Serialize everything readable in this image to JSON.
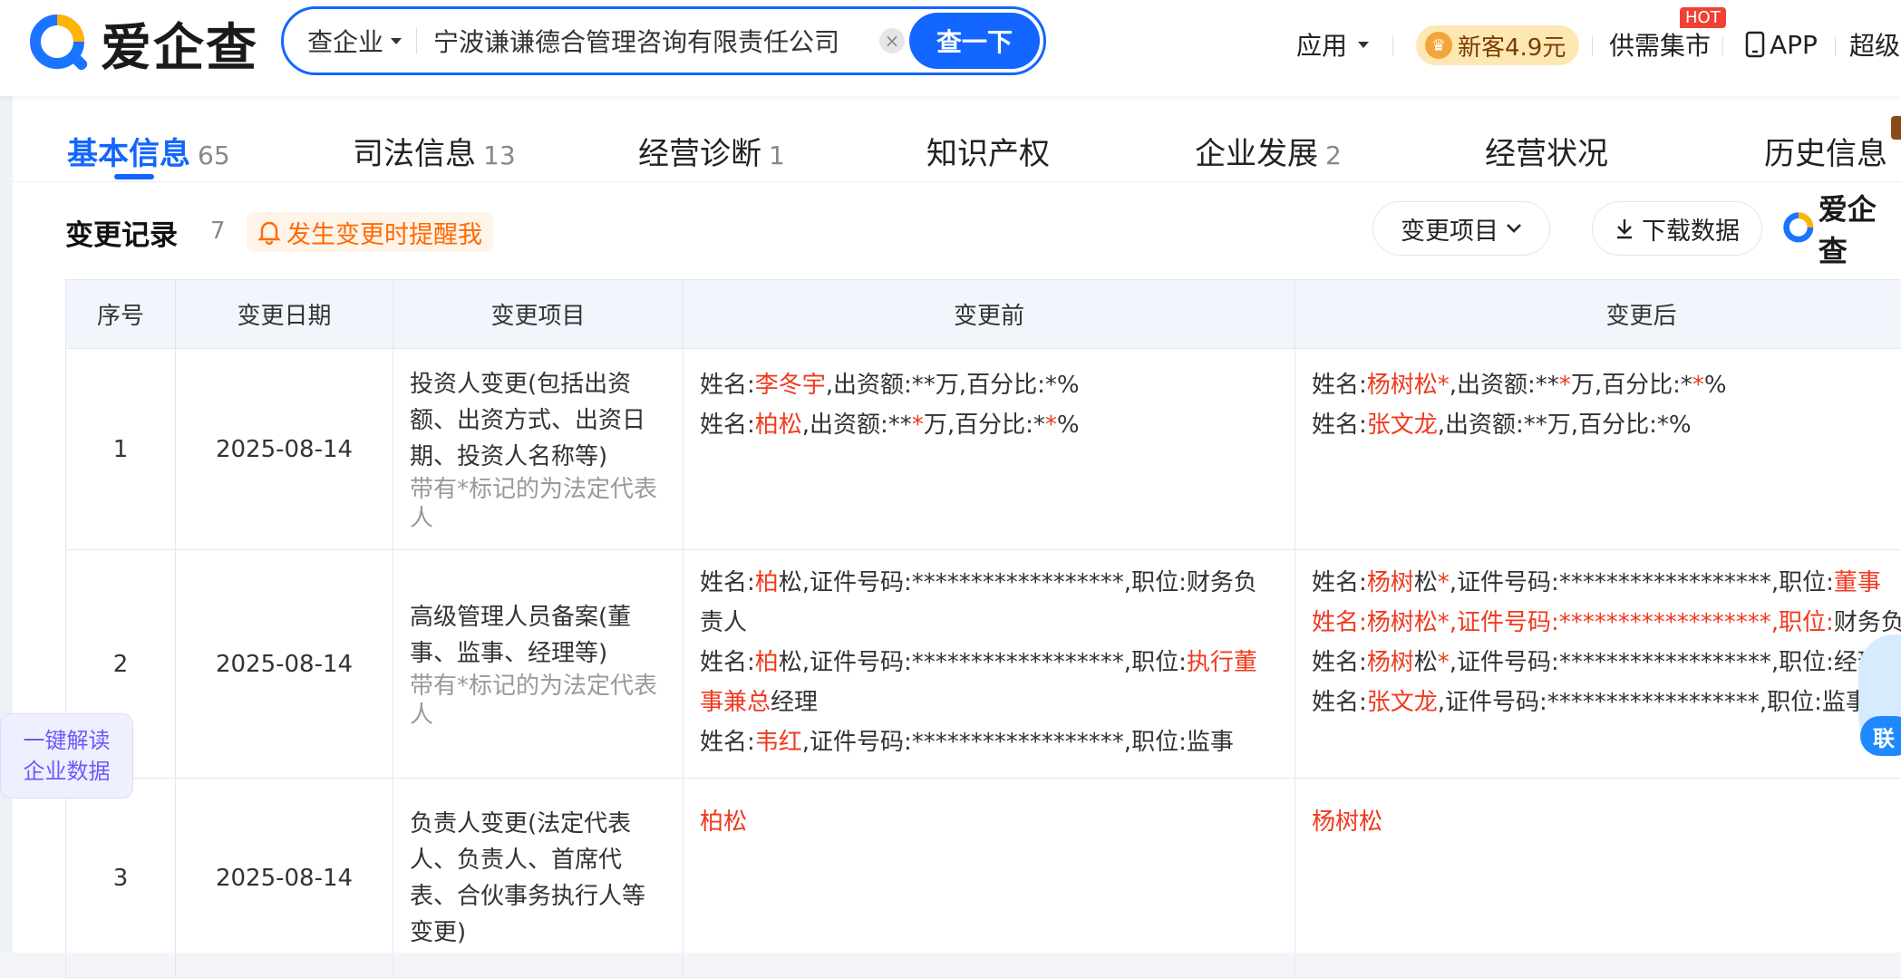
{
  "header": {
    "logo_text": "爱企查",
    "search": {
      "type_label": "查企业",
      "value": "宁波谦谦德合管理咨询有限责任公司",
      "clear_symbol": "×",
      "button": "查一下"
    },
    "nav": {
      "apps": "应用",
      "promo": "新客4.9元",
      "market": "供需集市",
      "hot_badge": "HOT",
      "app": "APP",
      "more": "超级"
    }
  },
  "tabs": [
    {
      "label": "基本信息",
      "count": "65"
    },
    {
      "label": "司法信息",
      "count": "13"
    },
    {
      "label": "经营诊断",
      "count": "1"
    },
    {
      "label": "知识产权",
      "count": ""
    },
    {
      "label": "企业发展",
      "count": "2"
    },
    {
      "label": "经营状况",
      "count": ""
    },
    {
      "label": "历史信息",
      "count": ""
    }
  ],
  "section": {
    "title": "变更记录",
    "count": "7",
    "remind": "发生变更时提醒我",
    "filter": "变更项目",
    "download": "下载数据",
    "watermark": "爱企查"
  },
  "table": {
    "headers": [
      "序号",
      "变更日期",
      "变更项目",
      "变更前",
      "变更后"
    ],
    "rows": [
      {
        "no": "1",
        "date": "2025-08-14",
        "item": "投资人变更(包括出资额、出资方式、出资日期、投资人名称等)",
        "note": "带有*标记的为法定代表人",
        "before": [
          [
            {
              "t": "姓名:"
            },
            {
              "t": "李冬宇",
              "r": true
            },
            {
              "t": ",出资额:**万,百分比:*%"
            }
          ],
          [
            {
              "t": "姓名:"
            },
            {
              "t": "柏松",
              "r": true
            },
            {
              "t": ",出资额:**"
            },
            {
              "t": "*",
              "r": true
            },
            {
              "t": "万,百分比:*"
            },
            {
              "t": "*",
              "r": true
            },
            {
              "t": "%"
            }
          ]
        ],
        "after": [
          [
            {
              "t": "姓名:"
            },
            {
              "t": "杨树松*",
              "r": true
            },
            {
              "t": ",出资额:**"
            },
            {
              "t": "*",
              "r": true
            },
            {
              "t": "万,百分比:*"
            },
            {
              "t": "*",
              "r": true
            },
            {
              "t": "%"
            }
          ],
          [
            {
              "t": "姓名:"
            },
            {
              "t": "张文龙",
              "r": true
            },
            {
              "t": ",出资额:**万,百分比:*%"
            }
          ]
        ]
      },
      {
        "no": "2",
        "date": "2025-08-14",
        "item": "高级管理人员备案(董事、监事、经理等)",
        "note": "带有*标记的为法定代表人",
        "before": [
          [
            {
              "t": "姓名:"
            },
            {
              "t": "柏",
              "r": true
            },
            {
              "t": "松,证件号码:******************,职位:财务负责人"
            }
          ],
          [
            {
              "t": "姓名:"
            },
            {
              "t": "柏",
              "r": true
            },
            {
              "t": "松,证件号码:******************,职位:"
            },
            {
              "t": "执行董事兼总",
              "r": true
            },
            {
              "t": "经理"
            }
          ],
          [
            {
              "t": "姓名:"
            },
            {
              "t": "韦红",
              "r": true
            },
            {
              "t": ",证件号码:******************,职位:监事"
            }
          ]
        ],
        "after": [
          [
            {
              "t": "姓名:"
            },
            {
              "t": "杨树",
              "r": true
            },
            {
              "t": "松"
            },
            {
              "t": "*",
              "r": true
            },
            {
              "t": ",证件号码:******************,职位:"
            },
            {
              "t": "董事",
              "r": true
            }
          ],
          [
            {
              "t": "姓名:杨树松*,证件号码:******************,职位:",
              "r": true
            },
            {
              "t": "财务负责人"
            }
          ],
          [
            {
              "t": "姓名:"
            },
            {
              "t": "杨树",
              "r": true
            },
            {
              "t": "松"
            },
            {
              "t": "*",
              "r": true
            },
            {
              "t": ",证件号码:******************,职位:经理"
            }
          ],
          [
            {
              "t": "姓名:"
            },
            {
              "t": "张文龙",
              "r": true
            },
            {
              "t": ",证件号码:******************,职位:监事"
            }
          ]
        ]
      },
      {
        "no": "3",
        "date": "2025-08-14",
        "item": "负责人变更(法定代表人、负责人、首席代表、合伙事务执行人等变更)",
        "note": "",
        "before": [
          [
            {
              "t": "柏松",
              "r": true
            }
          ]
        ],
        "after": [
          [
            {
              "t": "杨树松",
              "r": true
            }
          ]
        ]
      }
    ]
  },
  "floating": {
    "left_line1": "一键解读",
    "left_line2": "企业数据",
    "right": "联"
  },
  "colors": {
    "brand": "#1366ff",
    "highlight": "#f0391f",
    "remind": "#ff6a00"
  }
}
